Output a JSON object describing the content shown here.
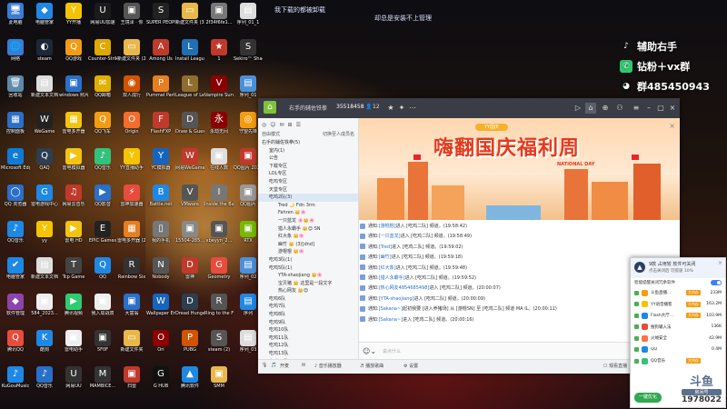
{
  "overlay": {
    "top_left_note": "我下载的都被卸载",
    "top_right_note": "却总是安装不上管理"
  },
  "promo": {
    "line1": "辅助右手",
    "line2": "钻粉＋vx群",
    "line3": "群485450943"
  },
  "desktop_icons": [
    {
      "label": "此电脑",
      "glyph": "🖥",
      "color": "#3a7bd5"
    },
    {
      "label": "电脑管家",
      "glyph": "◆",
      "color": "#1e88e5"
    },
    {
      "label": "YY开播",
      "glyph": "Y",
      "color": "#f5c400"
    },
    {
      "label": "网易UU加速",
      "glyph": "U",
      "color": "#1b1b1b"
    },
    {
      "label": "王境泽 · 你",
      "glyph": "▣",
      "color": "#555555"
    },
    {
      "label": "SUPER PEOPLE CBT",
      "glyph": "S",
      "color": "#222222"
    },
    {
      "label": "新建文件夹 (3)",
      "glyph": "▭",
      "color": "#e9b84a"
    },
    {
      "label": "2f34f6fe1...",
      "glyph": "▣",
      "color": "#777777"
    },
    {
      "label": "序列_01_1",
      "glyph": "▤",
      "color": "#dddddd"
    },
    {
      "label": "网络",
      "glyph": "🌐",
      "color": "#3a7bd5"
    },
    {
      "label": "steam",
      "glyph": "◐",
      "color": "#1b2838"
    },
    {
      "label": "QQ游戏",
      "glyph": "Q",
      "color": "#f39c12"
    },
    {
      "label": "Counter-Strike Global Off...",
      "glyph": "C",
      "color": "#e0a800"
    },
    {
      "label": "新建文件夹 (2)",
      "glyph": "▭",
      "color": "#e9b84a"
    },
    {
      "label": "Among Us",
      "glyph": "A",
      "color": "#c0392b"
    },
    {
      "label": "Install League o...",
      "glyph": "L",
      "color": "#1f6fb2"
    },
    {
      "label": "1",
      "glyph": "★",
      "color": "#c0392b"
    },
    {
      "label": "Sekiro™ Shadow...",
      "glyph": "S",
      "color": "#333333"
    },
    {
      "label": "回收站",
      "glyph": "🗑",
      "color": "#5d8aa8"
    },
    {
      "label": "新建文本文档",
      "glyph": "▤",
      "color": "#dddddd"
    },
    {
      "label": "windows 照片查看器",
      "glyph": "▣",
      "color": "#2a6fc9"
    },
    {
      "label": "QQ邮箱",
      "glyph": "✉",
      "color": "#e0b000"
    },
    {
      "label": "双人成行",
      "glyph": "◉",
      "color": "#d35400"
    },
    {
      "label": "Pummel Party",
      "glyph": "P",
      "color": "#e67e22"
    },
    {
      "label": "League of Legends",
      "glyph": "L",
      "color": "#8e6d2f"
    },
    {
      "label": "Vampire Survivors",
      "glyph": "V",
      "color": "#8b0000"
    },
    {
      "label": "序列_01",
      "glyph": "▤",
      "color": "#4a90d9"
    },
    {
      "label": "控制面板",
      "glyph": "▦",
      "color": "#2a6fc9"
    },
    {
      "label": "WeGame",
      "glyph": "W",
      "color": "#222222"
    },
    {
      "label": "雷电多开器",
      "glyph": "▦",
      "color": "#f1c40f"
    },
    {
      "label": "QQ飞车",
      "glyph": "Q",
      "color": "#f39c12"
    },
    {
      "label": "Origin",
      "glyph": "O",
      "color": "#f56c2d"
    },
    {
      "label": "FlashFXP",
      "glyph": "F",
      "color": "#c0392b"
    },
    {
      "label": "Draw & Guess",
      "glyph": "D",
      "color": "#555555"
    },
    {
      "label": "永劫无间",
      "glyph": "永",
      "color": "#8b0000"
    },
    {
      "label": "守望先锋",
      "glyph": "◎",
      "color": "#f39c12"
    },
    {
      "label": "Microsoft Edge",
      "glyph": "e",
      "color": "#0f7bd7"
    },
    {
      "label": "QAQ",
      "glyph": "Q",
      "color": "#2c3e50"
    },
    {
      "label": "雷电模拟器",
      "glyph": "▶",
      "color": "#f1c40f"
    },
    {
      "label": "QQ音乐",
      "glyph": "♪",
      "color": "#31c27c"
    },
    {
      "label": "YY直播助手",
      "glyph": "Y",
      "color": "#f5c400"
    },
    {
      "label": "YC模拟器",
      "glyph": "Y",
      "color": "#1565c0"
    },
    {
      "label": "网易WeGame...",
      "glyph": "W",
      "color": "#c0392b"
    },
    {
      "label": "在线人数",
      "glyph": "▣",
      "color": "#dddddd"
    },
    {
      "label": "QQ图片 20220...",
      "glyph": "▣",
      "color": "#c0392b"
    },
    {
      "label": "QQ 浏览器",
      "glyph": "◯",
      "color": "#2a6fc9"
    },
    {
      "label": "雷电游戏中心",
      "glyph": "G",
      "color": "#1e88e5"
    },
    {
      "label": "网易云音乐",
      "glyph": "♫",
      "color": "#c0392b"
    },
    {
      "label": "QQ影音",
      "glyph": "▶",
      "color": "#2a6fc9"
    },
    {
      "label": "雷神加速器",
      "glyph": "⚡",
      "color": "#e74c3c"
    },
    {
      "label": "Battle.net",
      "glyph": "B",
      "color": "#1e88e5"
    },
    {
      "label": "VMware",
      "glyph": "V",
      "color": "#555555"
    },
    {
      "label": "Inside the Backroo...",
      "glyph": "I",
      "color": "#777777"
    },
    {
      "label": "QQ图片",
      "glyph": "▣",
      "color": "#999999"
    },
    {
      "label": "QQ音乐",
      "glyph": "♪",
      "color": "#1e88e5"
    },
    {
      "label": "yy",
      "glyph": "Y",
      "color": "#f5c400"
    },
    {
      "label": "雷电 HD",
      "glyph": "▶",
      "color": "#f1c40f"
    },
    {
      "label": "EPIC Games",
      "glyph": "E",
      "color": "#222222"
    },
    {
      "label": "雷电多开器 (2)",
      "glyph": "▦",
      "color": "#e67e22"
    },
    {
      "label": "我的手机",
      "glyph": "▯",
      "color": "#777777"
    },
    {
      "label": "15504-285...",
      "glyph": "▣",
      "color": "#888888"
    },
    {
      "label": "xbeyyn_2...",
      "glyph": "▣",
      "color": "#555555"
    },
    {
      "label": "RTX",
      "glyph": "▣",
      "color": "#76b900"
    },
    {
      "label": "电脑管家",
      "glyph": "✔",
      "color": "#1e88e5"
    },
    {
      "label": "新建文本文档",
      "glyph": "▤",
      "color": "#dddddd"
    },
    {
      "label": "Tcp Game",
      "glyph": "T",
      "color": "#444444"
    },
    {
      "label": "QQ",
      "glyph": "Q",
      "color": "#1e88e5"
    },
    {
      "label": "Rainbow Six",
      "glyph": "R",
      "color": "#333333"
    },
    {
      "label": "Nobody",
      "glyph": "N",
      "color": "#555555"
    },
    {
      "label": "雷神",
      "glyph": "D",
      "color": "#c0392b"
    },
    {
      "label": "Geometry",
      "glyph": "G",
      "color": "#e74c3c"
    },
    {
      "label": "序列_02",
      "glyph": "▤",
      "color": "#4a90d9"
    },
    {
      "label": "软件管理",
      "glyph": "◆",
      "color": "#8e44ad"
    },
    {
      "label": "584_2023...",
      "glyph": "▣",
      "color": "#eeeeee"
    },
    {
      "label": "腾讯视频",
      "glyph": "▶",
      "color": "#2ecc71"
    },
    {
      "label": "我入局战双",
      "glyph": "▣",
      "color": "#eeeeee"
    },
    {
      "label": "大富翁",
      "glyph": "▣",
      "color": "#2a6fc9"
    },
    {
      "label": "Wallpaper Engine",
      "glyph": "W",
      "color": "#1565c0"
    },
    {
      "label": "Dread Hunger",
      "glyph": "D",
      "color": "#2c3e50"
    },
    {
      "label": "Ring to the Finish",
      "glyph": "R",
      "color": "#555555"
    },
    {
      "label": "序列",
      "glyph": "▤",
      "color": "#1e88e5"
    },
    {
      "label": "腾讯QQ",
      "glyph": "Q",
      "color": "#e74c3c"
    },
    {
      "label": "酷狗",
      "glyph": "K",
      "color": "#1e88e5"
    },
    {
      "label": "雷电助手",
      "glyph": "▣",
      "color": "#eeeeee"
    },
    {
      "label": "5F0F",
      "glyph": "▣",
      "color": "#333333"
    },
    {
      "label": "新建文件夹",
      "glyph": "▭",
      "color": "#e9b84a"
    },
    {
      "label": "Ori",
      "glyph": "O",
      "color": "#8b0000"
    },
    {
      "label": "PUBG",
      "glyph": "P",
      "color": "#d35400"
    },
    {
      "label": "steam (2)",
      "glyph": "S",
      "color": "#555555"
    },
    {
      "label": "序列_03",
      "glyph": "▤",
      "color": "#dddddd"
    },
    {
      "label": "KuGouMusic",
      "glyph": "♪",
      "color": "#1e88e5"
    },
    {
      "label": "QQ音乐",
      "glyph": "♪",
      "color": "#2a6fc9"
    },
    {
      "label": "网易UU",
      "glyph": "U",
      "color": "#333333"
    },
    {
      "label": "MAMBICE...",
      "glyph": "M",
      "color": "#333333"
    },
    {
      "label": "扫雷",
      "glyph": "▣",
      "color": "#c0392b"
    },
    {
      "label": "G HUB",
      "glyph": "G",
      "color": "#111111"
    },
    {
      "label": "腾讯软件",
      "glyph": "▲",
      "color": "#1e88e5"
    },
    {
      "label": "SMM",
      "glyph": "▣",
      "color": "#e9b84a"
    },
    {
      "label": "",
      "glyph": "",
      "color": "#000000"
    }
  ],
  "window": {
    "title": "右手的辅佐铁拳",
    "room_id": "35518458",
    "viewer_count": "12",
    "left_tools": [
      "◎",
      "☺",
      "✉",
      "⊞",
      "☰"
    ],
    "mode_label": "自由模式",
    "mode_right": "切换至人成员名",
    "channels": [
      "右手的辅佐铁拳(5)",
      "室内(1)",
      "公告",
      "下载专区",
      "LOL专区",
      "吃鸡专区",
      "天堂专区",
      "吃鸡2队(3)",
      "Tred 🌙 Fdn 3rm",
      "Fahren 👑🌸",
      "一只蓝龙 🌸👑🌸",
      "猎人永霸手 👑😊 SN",
      "红大象 👑🌸",
      "幽竹 👑 (3)[dnd]",
      "游棍棍 👑🌸",
      "吃鸡3队(1)",
      "吃鸡5队(1)",
      "YTA-shaojiang 👑🌸",
      "宝贝猪 👑 这里是一段文字",
      "热心网友 👑😊",
      "吃鸡6队",
      "吃鸡7队",
      "吃鸡8队",
      "吃鸡9队",
      "吃鸡10队",
      "吃鸡11队",
      "吃鸡12队",
      "吃鸡13队",
      "吃鸡14队",
      "吃鸡15队"
    ],
    "banner": {
      "tag": "YY国庆",
      "title": "嗨翻国庆福利周",
      "subtitle": "NATIONAL DAY",
      "close": "×"
    },
    "messages": [
      {
        "prefix": "通知:",
        "name": "[游棍棍]",
        "text": "进入 [吃鸡二队] 频道。(19:58:42)"
      },
      {
        "prefix": "通知:",
        "name": "[一只蓝龙]",
        "text": "进入 [吃鸡二队] 频道。(19:58:49)"
      },
      {
        "prefix": "通知:",
        "name": "[Tred]",
        "text": "进入 [吃鸡二队] 频道。(19:59:02)"
      },
      {
        "prefix": "通知:",
        "name": "[幽竹]",
        "text": "进入 [吃鸡二队] 频道。(19:59:18)"
      },
      {
        "prefix": "通知:",
        "name": "[红大象]",
        "text": "进入 [吃鸡二队] 频道。(19:59:48)"
      },
      {
        "prefix": "通知:",
        "name": "[猎人永霸手]",
        "text": "进入 [吃鸡二队] 频道。(19:59:52)"
      },
      {
        "prefix": "通知:",
        "name": "[热心网友4854685498]",
        "text": "进入 [吃鸡二队] 频道。(20:00:07)"
      },
      {
        "prefix": "通知:",
        "name": "[YTA-shaojiang]",
        "text": "进入 [吃鸡二队] 频道。(20:00:09)"
      },
      {
        "prefix": "通知:",
        "name": "[Sakana~]",
        "text": "起初我要 [进入养猪场] 从 [游棍SN] 至 [吃鸡二队] 频道 MA IL。(20:00:11)"
      },
      {
        "prefix": "通知:",
        "name": "[Sakana~]",
        "text": "进入 [吃鸡二队] 频道。(20:00:16)"
      }
    ],
    "input_placeholder": "说点什么",
    "send_label": "发送",
    "bottom_items": [
      "🎙",
      "🎵",
      "开麦",
      "✉",
      "♪ 音乐播放器",
      "♬ 播放歌曲",
      "⚙ 设置",
      "☐ 观看直播",
      "⤢"
    ]
  },
  "popup": {
    "title": "9款 占用较 软件可关闭",
    "subtitle": "点击关闭后 可提速 10%",
    "option_label": "智能提醒关闭冗余软件",
    "rows": [
      {
        "name": "斗鱼直播...",
        "tag": "大内存",
        "size": "233M",
        "color": "#f39c12"
      },
      {
        "name": "YY语音播客",
        "tag": "大内存",
        "size": "163.2M",
        "color": "#f5c400"
      },
      {
        "name": "Flash大厅...",
        "tag": "大内存",
        "size": "103.9M",
        "color": "#1e88e5"
      },
      {
        "name": "搜狗输入法",
        "tag": "",
        "size": "136K",
        "color": "#e74c3c"
      },
      {
        "name": "火绒安全",
        "tag": "",
        "size": "42.9M",
        "color": "#ff7043"
      },
      {
        "name": "QQ",
        "tag": "",
        "size": "0.4M",
        "color": "#1e88e5"
      },
      {
        "name": "QQ音乐",
        "tag": "大内存",
        "size": "",
        "color": "#31c27c"
      }
    ],
    "button_label": "一键优化",
    "watermark_top": "斗鱼",
    "watermark_mid": "房间号",
    "watermark_room": "1978022"
  }
}
